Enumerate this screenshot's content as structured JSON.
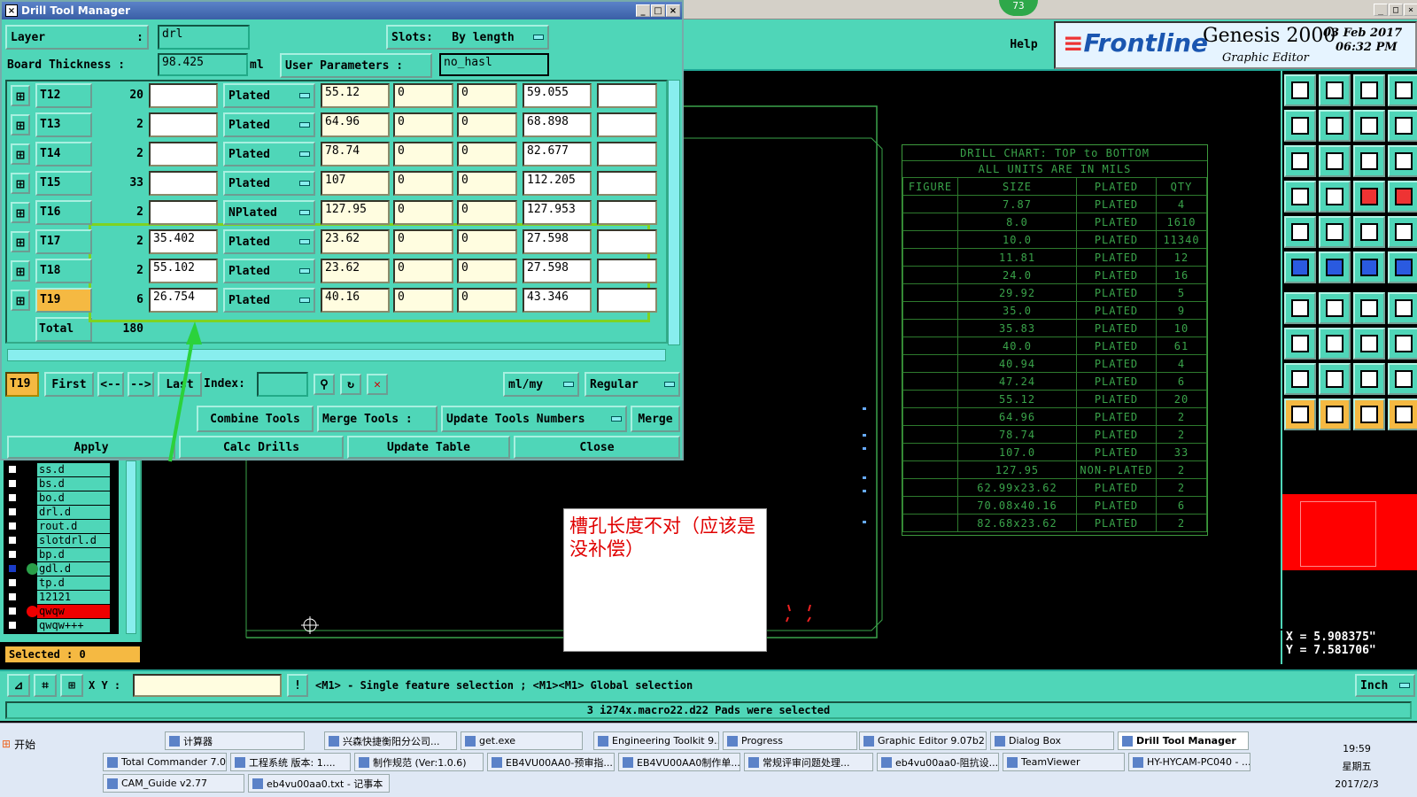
{
  "dialog": {
    "title": "Drill Tool Manager",
    "layer_label": "Layer",
    "layer_value": "drl",
    "slots_label": "Slots:",
    "slots_value": "By length",
    "board_thickness_label": "Board Thickness :",
    "board_thickness_value": "98.425",
    "board_thickness_unit": "ml",
    "user_params_label": "User Parameters :",
    "user_params_value": "no_hasl",
    "rows": [
      {
        "tool": "T12",
        "count": "20",
        "finish": "",
        "type": "Plated",
        "size": "55.12",
        "tp": "0",
        "tm": "0",
        "drill": "59.055",
        "extra": ""
      },
      {
        "tool": "T13",
        "count": "2",
        "finish": "",
        "type": "Plated",
        "size": "64.96",
        "tp": "0",
        "tm": "0",
        "drill": "68.898",
        "extra": ""
      },
      {
        "tool": "T14",
        "count": "2",
        "finish": "",
        "type": "Plated",
        "size": "78.74",
        "tp": "0",
        "tm": "0",
        "drill": "82.677",
        "extra": ""
      },
      {
        "tool": "T15",
        "count": "33",
        "finish": "",
        "type": "Plated",
        "size": "107",
        "tp": "0",
        "tm": "0",
        "drill": "112.205",
        "extra": ""
      },
      {
        "tool": "T16",
        "count": "2",
        "finish": "",
        "type": "NPlated",
        "size": "127.95",
        "tp": "0",
        "tm": "0",
        "drill": "127.953",
        "extra": ""
      },
      {
        "tool": "T17",
        "count": "2",
        "finish": "35.402",
        "type": "Plated",
        "size": "23.62",
        "tp": "0",
        "tm": "0",
        "drill": "27.598",
        "extra": ""
      },
      {
        "tool": "T18",
        "count": "2",
        "finish": "55.102",
        "type": "Plated",
        "size": "23.62",
        "tp": "0",
        "tm": "0",
        "drill": "27.598",
        "extra": ""
      },
      {
        "tool": "T19",
        "count": "6",
        "finish": "26.754",
        "type": "Plated",
        "size": "40.16",
        "tp": "0",
        "tm": "0",
        "drill": "43.346",
        "extra": ""
      }
    ],
    "total_label": "Total",
    "total_value": "180",
    "current_tool": "T19",
    "first": "First",
    "prev": "<--",
    "next": "-->",
    "last": "Last",
    "index_label": "Index:",
    "units": "ml/my",
    "mode": "Regular",
    "combine": "Combine Tools",
    "merge_tools": "Merge Tools :",
    "update_numbers": "Update Tools Numbers",
    "merge": "Merge",
    "apply": "Apply",
    "calc": "Calc Drills",
    "update_table": "Update Table",
    "close": "Close"
  },
  "header": {
    "help": "Help",
    "brand": "Frontline",
    "product": "Genesis 2000",
    "subtitle": "Graphic Editor",
    "date": "03 Feb 2017",
    "time": "06:32 PM",
    "badge": "73"
  },
  "drill_chart": {
    "title1": "DRILL CHART: TOP to BOTTOM",
    "title2": "ALL UNITS ARE IN MILS",
    "headers": [
      "FIGURE",
      "SIZE",
      "PLATED",
      "QTY"
    ],
    "rows": [
      [
        "",
        "7.87",
        "PLATED",
        "4"
      ],
      [
        "",
        "8.0",
        "PLATED",
        "1610"
      ],
      [
        "",
        "10.0",
        "PLATED",
        "11340"
      ],
      [
        "",
        "11.81",
        "PLATED",
        "12"
      ],
      [
        "",
        "24.0",
        "PLATED",
        "16"
      ],
      [
        "",
        "29.92",
        "PLATED",
        "5"
      ],
      [
        "",
        "35.0",
        "PLATED",
        "9"
      ],
      [
        "",
        "35.83",
        "PLATED",
        "10"
      ],
      [
        "",
        "40.0",
        "PLATED",
        "61"
      ],
      [
        "",
        "40.94",
        "PLATED",
        "4"
      ],
      [
        "",
        "47.24",
        "PLATED",
        "6"
      ],
      [
        "",
        "55.12",
        "PLATED",
        "20"
      ],
      [
        "",
        "64.96",
        "PLATED",
        "2"
      ],
      [
        "",
        "78.74",
        "PLATED",
        "2"
      ],
      [
        "",
        "107.0",
        "PLATED",
        "33"
      ],
      [
        "",
        "127.95",
        "NON-PLATED",
        "2"
      ],
      [
        "",
        "62.99x23.62",
        "PLATED",
        "2"
      ],
      [
        "",
        "70.08x40.16",
        "PLATED",
        "6"
      ],
      [
        "",
        "82.68x23.62",
        "PLATED",
        "2"
      ]
    ]
  },
  "note": "槽孔长度不对（应该是没补偿）",
  "layers": [
    "ss.d",
    "bs.d",
    "bo.d",
    "drl.d",
    "rout.d",
    "slotdrl.d",
    "bp.d",
    "gdl.d",
    "tp.d",
    "12121",
    "qwqw",
    "qwqw+++"
  ],
  "selected": "Selected : 0",
  "coords": {
    "x": "X = 5.908375\"",
    "y": "Y = 7.581706\""
  },
  "status": {
    "xy_label": "X Y :",
    "hint": "<M1> - Single feature selection ; <M1><M1> Global selection",
    "units": "Inch",
    "message": "3 i274x.macro22.d22 Pads were selected"
  },
  "taskbar": {
    "start": "开始",
    "row1": [
      "计算器",
      "兴森快捷衡阳分公司...",
      "get.exe",
      "Engineering Toolkit 9....",
      "Progress",
      "Graphic Editor 9.07b2 ...",
      "Dialog Box",
      "Drill Tool Manager"
    ],
    "row2": [
      "Total Commander 7.0...",
      "工程系统 版本: 1....",
      "制作规范 (Ver:1.0.6)",
      "EB4VU00AA0-预审指...",
      "EB4VU00AA0制作单...",
      "常规评审问题处理...",
      "eb4vu00aa0-阻抗设...",
      "TeamViewer",
      "HY-HYCAM-PC040 - ..."
    ],
    "row3": [
      "CAM_Guide v2.77",
      "eb4vu00aa0.txt - 记事本"
    ],
    "clock": "19:59",
    "weekday": "星期五",
    "date": "2017/2/3"
  },
  "colors": {
    "teal": "#4fd6b8",
    "chart_green": "#3aa34a",
    "highlight": "#7ed321",
    "note_red": "#e00000",
    "red_box": "#ff0000"
  }
}
